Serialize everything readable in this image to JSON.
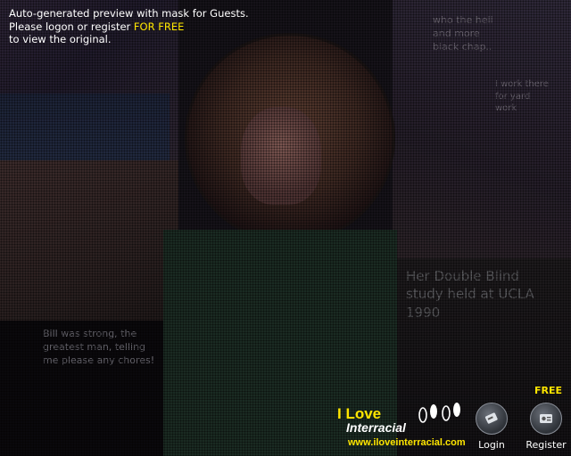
{
  "notice": {
    "line1": "Auto-generated preview with mask for Guests.",
    "line2_prefix": "Please logon or register ",
    "line2_highlight": "FOR FREE",
    "line3": "to view the original."
  },
  "comic": {
    "caption_top_right": "who the hell and more black chap..",
    "caption_mid_right": "I work there for yard work",
    "caption_right_large": "Her Double Blind study held at UCLA 1990",
    "caption_left": "Bill was strong, the greatest man, telling me please any chores!"
  },
  "brand": {
    "line1": "I Love",
    "line2": "Interracial",
    "url": "www.iloveinterracial.com"
  },
  "actions": {
    "login_label": "Login",
    "register_label": "Register",
    "free_badge": "FREE"
  },
  "colors": {
    "highlight": "#ffe600",
    "text": "#ffffff",
    "background": "#0d0b10"
  },
  "icons": {
    "login": "key-card-icon",
    "register": "id-card-icon",
    "logo": "footprints-icon"
  }
}
